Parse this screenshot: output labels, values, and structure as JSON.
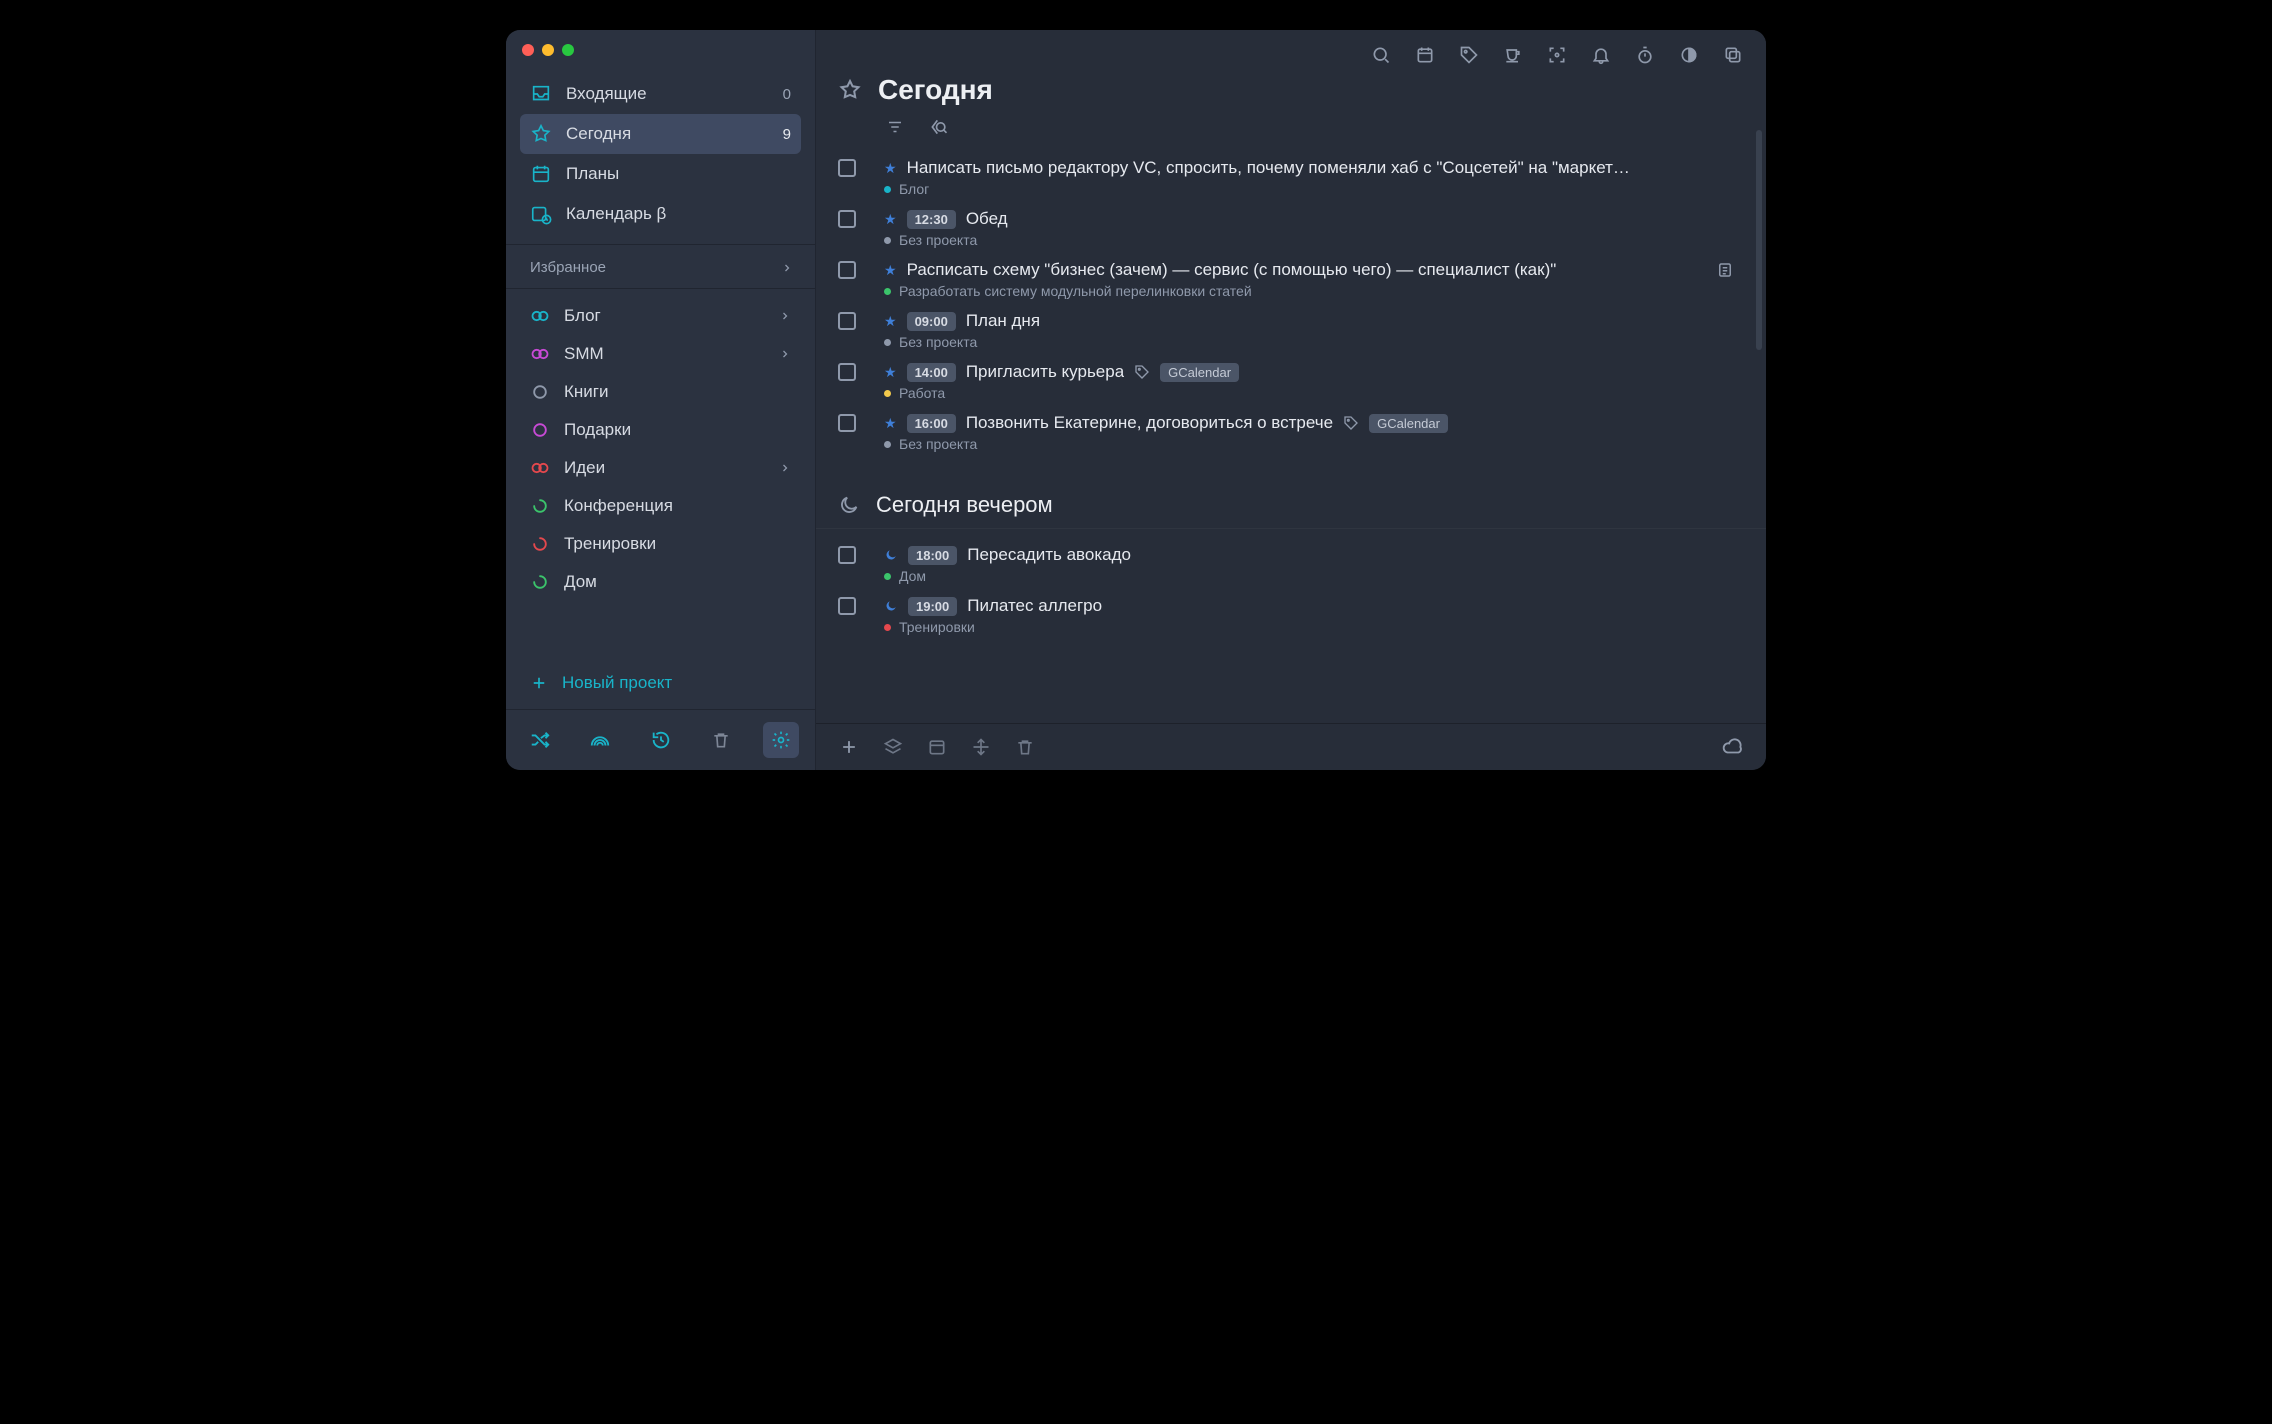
{
  "sidebar": {
    "nav": [
      {
        "id": "inbox",
        "label": "Входящие",
        "count": "0"
      },
      {
        "id": "today",
        "label": "Сегодня",
        "count": "9"
      },
      {
        "id": "plans",
        "label": "Планы"
      },
      {
        "id": "calendar",
        "label": "Календарь β"
      }
    ],
    "section_label": "Избранное",
    "projects": [
      {
        "label": "Блог",
        "color": "#19B4C9",
        "shape": "loops",
        "expandable": true
      },
      {
        "label": "SMM",
        "color": "#C84AD6",
        "shape": "loops",
        "expandable": true
      },
      {
        "label": "Книги",
        "color": "#8F99AB",
        "shape": "ring",
        "expandable": false
      },
      {
        "label": "Подарки",
        "color": "#C84AD6",
        "shape": "ring",
        "expandable": false
      },
      {
        "label": "Идеи",
        "color": "#E5484D",
        "shape": "loops",
        "expandable": true
      },
      {
        "label": "Конференция",
        "color": "#3BC46B",
        "shape": "ring-cut",
        "expandable": false
      },
      {
        "label": "Тренировки",
        "color": "#E5484D",
        "shape": "ring-cut",
        "expandable": false
      },
      {
        "label": "Дом",
        "color": "#3BC46B",
        "shape": "ring-cut",
        "expandable": false
      }
    ],
    "new_project": "Новый проект"
  },
  "main": {
    "title": "Сегодня",
    "tasks": [
      {
        "marker": "star",
        "time": null,
        "text": "Написать письмо редактору VC, спросить, почему поменяли хаб с \"Соцсетей\" на \"маркет…",
        "proj": "Блог",
        "dot": "#19B4C9",
        "tags": [],
        "note": false
      },
      {
        "marker": "star",
        "time": "12:30",
        "text": "Обед",
        "proj": "Без проекта",
        "dot": "#8F99AB",
        "tags": [],
        "note": false
      },
      {
        "marker": "star",
        "time": null,
        "text": "Расписать схему \"бизнес (зачем) — сервис (с помощью чего) — специалист (как)\"",
        "proj": "Разработать систему модульной перелинковки статей",
        "dot": "#3BC46B",
        "tags": [],
        "note": true
      },
      {
        "marker": "star",
        "time": "09:00",
        "text": "План дня",
        "proj": "Без проекта",
        "dot": "#8F99AB",
        "tags": [],
        "note": false
      },
      {
        "marker": "star",
        "time": "14:00",
        "text": "Пригласить курьера",
        "proj": "Работа",
        "dot": "#F2C94C",
        "tags": [
          "GCalendar"
        ],
        "note": false
      },
      {
        "marker": "star",
        "time": "16:00",
        "text": "Позвонить Екатерине, договориться о встрече",
        "proj": "Без проекта",
        "dot": "#8F99AB",
        "tags": [
          "GCalendar"
        ],
        "note": false
      }
    ],
    "evening_title": "Сегодня вечером",
    "evening": [
      {
        "marker": "moon",
        "time": "18:00",
        "text": "Пересадить авокадо",
        "proj": "Дом",
        "dot": "#3BC46B",
        "tags": [],
        "note": false
      },
      {
        "marker": "moon",
        "time": "19:00",
        "text": "Пилатес аллегро",
        "proj": "Тренировки",
        "dot": "#E5484D",
        "tags": [],
        "note": false
      }
    ]
  }
}
